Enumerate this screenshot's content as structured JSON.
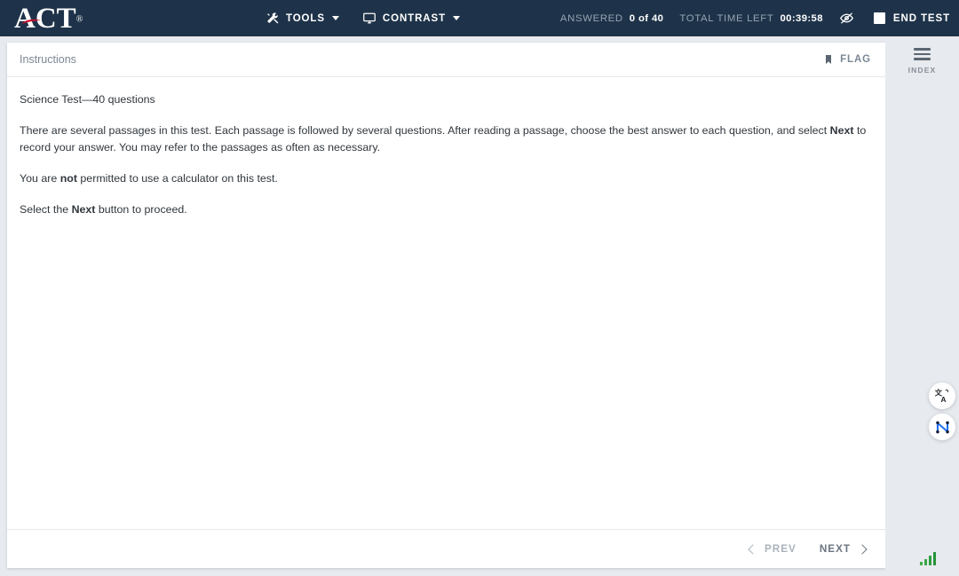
{
  "topbar": {
    "logo": {
      "text": "ACT",
      "registered": "®",
      "icon": "act-logo"
    },
    "menu": [
      {
        "label": "TOOLS",
        "icon": "tools-icon"
      },
      {
        "label": "CONTRAST",
        "icon": "monitor-icon"
      }
    ],
    "status": {
      "answered_label": "ANSWERED",
      "answered_value": "0 of 40",
      "time_label": "TOTAL TIME LEFT",
      "time_value": "00:39:58",
      "hide_timer_icon": "eye-slash-icon",
      "end_test_label": "END TEST"
    }
  },
  "card": {
    "header": {
      "title": "Instructions",
      "flag_label": "FLAG",
      "flag_icon": "bookmark-icon"
    },
    "paragraphs": {
      "p1": "Science Test—40 questions",
      "p2_a": "There are several passages in this test. Each passage is followed by several questions. After reading a passage, choose the best answer to each question, and select ",
      "p2_b": "Next",
      "p2_c": " to record your answer. You may refer to the passages as often as necessary.",
      "p3_a": "You are ",
      "p3_b": "not",
      "p3_c": " permitted to use a calculator on this test.",
      "p4_a": "Select the ",
      "p4_b": "Next",
      "p4_c": " button to proceed."
    },
    "footer": {
      "prev_label": "PREV",
      "next_label": "NEXT"
    }
  },
  "rail": {
    "index_label": "INDEX",
    "index_icon": "hamburger-icon",
    "floating_buttons": [
      {
        "icon": "translate-icon"
      },
      {
        "icon": "network-nodes-icon"
      }
    ],
    "signal_icon": "signal-bars-icon"
  },
  "colors": {
    "topbar_bg": "#1e3349",
    "page_bg": "#e7eaee",
    "card_bg": "#ffffff",
    "accent_red": "#c8102e",
    "signal_green": "#2e9e3e",
    "network_blue": "#1f6fec"
  }
}
